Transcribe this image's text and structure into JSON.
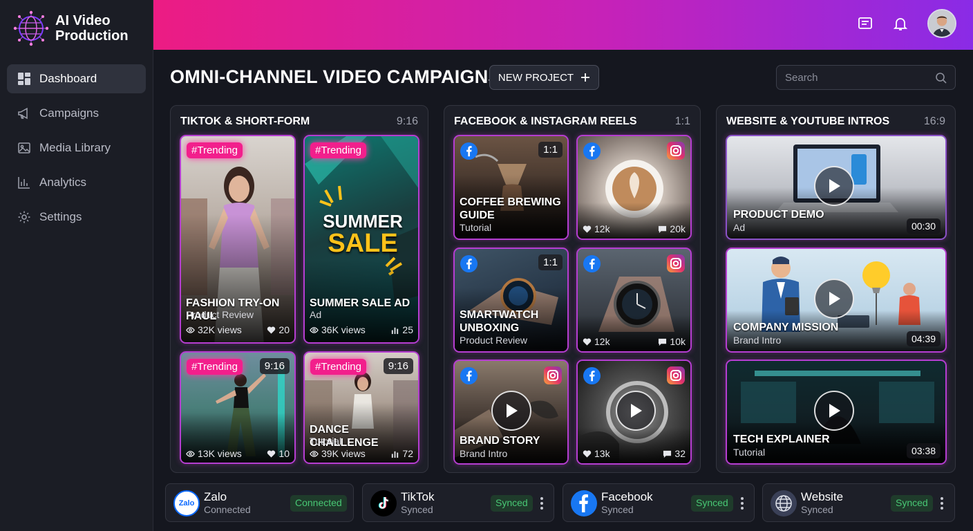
{
  "app": {
    "name_line1": "AI Video",
    "name_line2": "Production"
  },
  "nav": [
    {
      "label": "Dashboard",
      "icon": "dashboard-icon",
      "active": true
    },
    {
      "label": "Campaigns",
      "icon": "megaphone-icon"
    },
    {
      "label": "Media Library",
      "icon": "image-icon"
    },
    {
      "label": "Analytics",
      "icon": "bar-chart-icon"
    },
    {
      "label": "Settings",
      "icon": "gear-icon"
    }
  ],
  "header": {
    "title": "OMNI-CHANNEL VIDEO CAMPAIGNS",
    "new_project_label": "NEW PROJECT",
    "search_placeholder": "Search"
  },
  "panels": {
    "tiktok": {
      "title": "TIKTOK & SHORT-FORM",
      "ratio": "9:16",
      "cards": [
        {
          "badge": "#Trending",
          "title": "FASHION TRY-ON HAUL",
          "subtitle": "Product Review",
          "views": "32K views",
          "likes": "20"
        },
        {
          "badge": "#Trending",
          "title": "SUMMER SALE AD",
          "subtitle": "Ad",
          "views": "36K views",
          "stat": "25",
          "overlay_line1": "SUMMER",
          "overlay_line2": "SALE"
        },
        {
          "badge": "#Trending",
          "ratio": "9:16",
          "views": "13K views",
          "likes": "10"
        },
        {
          "badge": "#Trending",
          "ratio": "9:16",
          "title": "DANCE CHALLENGE",
          "subtitle": "Tutorial",
          "views": "39K views",
          "stat": "72"
        }
      ]
    },
    "facebook": {
      "title": "FACEBOOK & INSTAGRAM REELS",
      "ratio": "1:1",
      "cards": [
        {
          "ratio": "1:1",
          "title_line1": "COFFEE BREWING",
          "title_line2": "GUIDE",
          "subtitle": "Tutorial"
        },
        {
          "likes": "12k",
          "comments": "20k"
        },
        {
          "ratio": "1:1",
          "title_line1": "SMARTWATCH",
          "title_line2": "UNBOXING",
          "subtitle": "Product Review"
        },
        {
          "likes": "12k",
          "comments": "10k"
        },
        {
          "title": "BRAND STORY",
          "subtitle": "Brand Intro"
        },
        {
          "likes": "13k",
          "comments": "32"
        }
      ]
    },
    "website": {
      "title": "WEBSITE & YOUTUBE INTROS",
      "ratio": "16:9",
      "cards": [
        {
          "title": "PRODUCT DEMO",
          "subtitle": "Ad",
          "duration": "00:30"
        },
        {
          "title": "COMPANY MISSION",
          "subtitle": "Brand Intro",
          "duration": "04:39"
        },
        {
          "title": "TECH EXPLAINER",
          "subtitle": "Tutorial",
          "duration": "03:38"
        }
      ]
    }
  },
  "integrations": [
    {
      "name": "Zalo",
      "status": "Connected",
      "badge": "Connected",
      "logo_text": "Zalo"
    },
    {
      "name": "TikTok",
      "status": "Synced",
      "badge": "Synced"
    },
    {
      "name": "Facebook",
      "status": "Synced",
      "badge": "Synced"
    },
    {
      "name": "Website",
      "status": "Synced",
      "badge": "Synced"
    }
  ],
  "colors": {
    "accent_pink": "#ec1c83",
    "accent_purple": "#8a2be6",
    "trending": "#f21f8c",
    "synced_green": "#48c774",
    "facebook_blue": "#1877f2"
  }
}
